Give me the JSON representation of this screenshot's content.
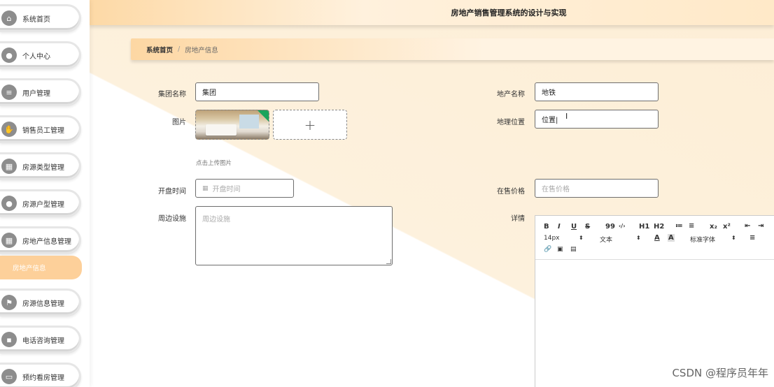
{
  "app": {
    "title": "房地产销售管理系统的设计与实现"
  },
  "breadcrumb": {
    "home": "系统首页",
    "separator": "/",
    "current": "房地产信息"
  },
  "sidebar": {
    "items": [
      {
        "label": "系统首页",
        "icon": "home-icon"
      },
      {
        "label": "个人中心",
        "icon": "user-icon"
      },
      {
        "label": "用户管理",
        "icon": "list-icon"
      },
      {
        "label": "销售员工管理",
        "icon": "hand-icon"
      },
      {
        "label": "房源类型管理",
        "icon": "grid-icon"
      },
      {
        "label": "房源户型管理",
        "icon": "bulb-icon"
      },
      {
        "label": "房地产信息管理",
        "icon": "grid-icon"
      },
      {
        "label": "房源信息管理",
        "icon": "flag-icon"
      },
      {
        "label": "电话咨询管理",
        "icon": "sign-icon"
      },
      {
        "label": "预约看房管理",
        "icon": "monitor-icon"
      }
    ],
    "active_sub": "房地产信息"
  },
  "form": {
    "group_name": {
      "label": "集团名称",
      "value": "集团"
    },
    "estate_name": {
      "label": "地产名称",
      "value": "地铁"
    },
    "image": {
      "label": "图片",
      "add": "+",
      "hint": "点击上传图片"
    },
    "location": {
      "label": "地理位置",
      "value": "位置|"
    },
    "open_time": {
      "label": "开盘时间",
      "placeholder": "开盘时间"
    },
    "price": {
      "label": "在售价格",
      "placeholder": "在售价格"
    },
    "facilities": {
      "label": "周边设施",
      "placeholder": "周边设施"
    },
    "details": {
      "label": "详情"
    }
  },
  "editor": {
    "bold": "B",
    "italic": "I",
    "underline": "U",
    "strike": "S",
    "quote": "99",
    "code": "‹/›",
    "h1": "H1",
    "h2": "H2",
    "ordered": "≔",
    "bullet": "≡",
    "sub": "x₂",
    "sup": "x²",
    "outdent": "⇤",
    "indent": "⇥",
    "size": "14px",
    "type": "文本",
    "font": "标准字体",
    "color": "A",
    "bg": "A",
    "align": "≡"
  },
  "watermark": "CSDN @程序员年年",
  "cursor_glyph": "I"
}
